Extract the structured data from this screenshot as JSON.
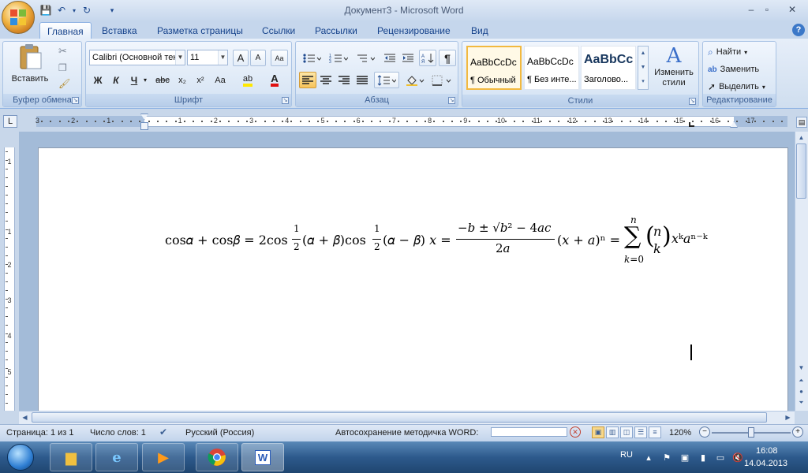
{
  "window": {
    "title": "Документ3 - Microsoft Word",
    "controls": {
      "minimize": "‒",
      "maximize": "▫",
      "close": "✕"
    }
  },
  "quick_access": {
    "save_icon": "💾",
    "undo_icon": "↶",
    "redo_icon": "↻",
    "customize_icon": "▾"
  },
  "ribbon": {
    "tabs": [
      "Главная",
      "Вставка",
      "Разметка страницы",
      "Ссылки",
      "Рассылки",
      "Рецензирование",
      "Вид"
    ],
    "active_tab": "Главная",
    "help": "?",
    "groups": {
      "clipboard": {
        "label": "Буфер обмена",
        "paste_label": "Вставить"
      },
      "font": {
        "label": "Шрифт",
        "font_name": "Calibri (Основной текст)",
        "font_size": "11",
        "grow": "A",
        "shrink": "A",
        "clear_format": "Aa",
        "bold": "Ж",
        "italic": "К",
        "underline": "Ч",
        "strike": "abc",
        "subscript": "x₂",
        "superscript": "x²",
        "change_case": "Аа",
        "highlight": "ab",
        "font_color": "A"
      },
      "paragraph": {
        "label": "Абзац",
        "pilcrow": "¶"
      },
      "styles": {
        "label": "Стили",
        "items": [
          {
            "sample": "AaBbCcDc",
            "name": "¶ Обычный"
          },
          {
            "sample": "AaBbCcDc",
            "name": "¶ Без инте..."
          },
          {
            "sample": "AaBbCc",
            "name": "Заголово..."
          }
        ],
        "change_styles": "Изменить стили"
      },
      "editing": {
        "label": "Редактирование",
        "find": "Найти",
        "replace": "Заменить",
        "select": "Выделить"
      }
    }
  },
  "ruler": {
    "corner": "L",
    "numbers": [
      "3",
      "2",
      "1",
      "1",
      "2",
      "3",
      "4",
      "5",
      "6",
      "7",
      "8",
      "9",
      "10",
      "11",
      "12",
      "13",
      "14",
      "15",
      "16",
      "17"
    ],
    "vertical_numbers": [
      "1",
      "1",
      "2",
      "3",
      "4",
      "5"
    ]
  },
  "document": {
    "equation": {
      "p1": "cos𝛼 + cos𝛽 = 2cos",
      "f1_num": "1",
      "f1_den": "2",
      "p2": "(𝛼 + 𝛽)cos",
      "f2_num": "1",
      "f2_den": "2",
      "p3": "(𝛼 − 𝛽) 𝑥 =",
      "f3_num": "−𝑏 ± √𝑏² − 4𝑎𝑐",
      "f3_den": "2𝑎",
      "p4": "(𝑥 + 𝑎)ⁿ =",
      "sum_upper": "𝑛",
      "sum_symbol": "∑",
      "sum_lower": "𝑘=0",
      "binom_top": "𝑛",
      "binom_bottom": "𝑘",
      "binom_left": "(",
      "binom_right": ")",
      "tail": "𝑥ᵏ𝑎ⁿ⁻ᵏ"
    }
  },
  "status": {
    "page": "Страница: 1 из 1",
    "words": "Число слов: 1",
    "language": "Русский (Россия)",
    "autosave": "Автосохранение методичка WORD:",
    "cancel": "✕",
    "zoom": "120%",
    "zoom_out": "−",
    "zoom_in": "+"
  },
  "taskbar": {
    "lang": "RU",
    "time": "16:08",
    "date": "14.04.2013"
  }
}
